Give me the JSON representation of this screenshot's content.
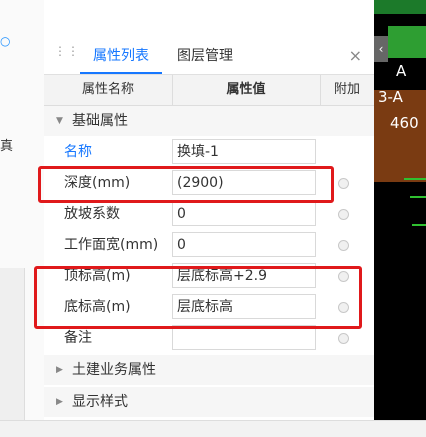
{
  "left_strip": {
    "label": "真"
  },
  "tabs": [
    {
      "label": "属性列表",
      "active": true
    },
    {
      "label": "图层管理",
      "active": false
    }
  ],
  "close_symbol": "×",
  "table_header": {
    "name": "属性名称",
    "value": "属性值",
    "extra": "附加"
  },
  "groups": {
    "basic": "基础属性",
    "civil": "土建业务属性",
    "display": "显示样式"
  },
  "rows": [
    {
      "name": "名称",
      "value": "换填-1",
      "has_radio": false
    },
    {
      "name": "深度(mm)",
      "value": "(2900)",
      "has_radio": true
    },
    {
      "name": "放坡系数",
      "value": "0",
      "has_radio": true
    },
    {
      "name": "工作面宽(mm)",
      "value": "0",
      "has_radio": true
    },
    {
      "name": "顶标高(m)",
      "value": "层底标高+2.9",
      "has_radio": true
    },
    {
      "name": "底标高(m)",
      "value": "层底标高",
      "has_radio": true
    },
    {
      "name": "备注",
      "value": "",
      "has_radio": true
    }
  ],
  "cad_labels": [
    "A",
    "3-A",
    "460"
  ],
  "colors": {
    "accent": "#1677ff",
    "highlight": "#e0191b"
  }
}
